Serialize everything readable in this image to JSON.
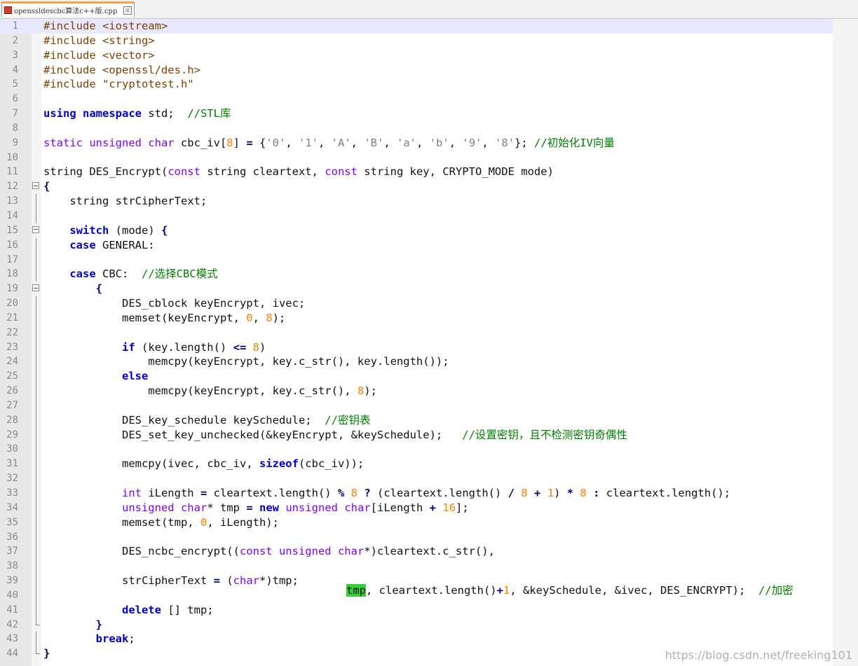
{
  "tab": {
    "filename": "openssldescbc算法c++版.cpp",
    "close": "☒"
  },
  "editor": {
    "current_line": 1,
    "lines": [
      {
        "n": "1",
        "tokens": [
          {
            "t": "#include <iostream>",
            "c": "pp"
          }
        ]
      },
      {
        "n": "2",
        "tokens": [
          {
            "t": "#include <string>",
            "c": "pp"
          }
        ]
      },
      {
        "n": "3",
        "tokens": [
          {
            "t": "#include <vector>",
            "c": "pp"
          }
        ]
      },
      {
        "n": "4",
        "tokens": [
          {
            "t": "#include <openssl/des.h>",
            "c": "pp"
          }
        ]
      },
      {
        "n": "5",
        "tokens": [
          {
            "t": "#include \"cryptotest.h\"",
            "c": "pp"
          }
        ]
      },
      {
        "n": "6",
        "tokens": []
      },
      {
        "n": "7",
        "tokens": [
          {
            "t": "using namespace",
            "c": "kw"
          },
          {
            "t": " std;  "
          },
          {
            "t": "//STL库",
            "c": "cm"
          }
        ]
      },
      {
        "n": "8",
        "tokens": []
      },
      {
        "n": "9",
        "tokens": [
          {
            "t": "static unsigned char",
            "c": "tp"
          },
          {
            "t": " cbc_iv["
          },
          {
            "t": "8",
            "c": "num"
          },
          {
            "t": "] "
          },
          {
            "t": "=",
            "c": "op"
          },
          {
            "t": " {"
          },
          {
            "t": "'0'",
            "c": "str"
          },
          {
            "t": ", "
          },
          {
            "t": "'1'",
            "c": "str"
          },
          {
            "t": ", "
          },
          {
            "t": "'A'",
            "c": "str"
          },
          {
            "t": ", "
          },
          {
            "t": "'B'",
            "c": "str"
          },
          {
            "t": ", "
          },
          {
            "t": "'a'",
            "c": "str"
          },
          {
            "t": ", "
          },
          {
            "t": "'b'",
            "c": "str"
          },
          {
            "t": ", "
          },
          {
            "t": "'9'",
            "c": "str"
          },
          {
            "t": ", "
          },
          {
            "t": "'8'",
            "c": "str"
          },
          {
            "t": "}; "
          },
          {
            "t": "//初始化IV向量",
            "c": "cm"
          }
        ]
      },
      {
        "n": "10",
        "tokens": []
      },
      {
        "n": "11",
        "tokens": [
          {
            "t": "string DES_Encrypt("
          },
          {
            "t": "const",
            "c": "tp"
          },
          {
            "t": " string cleartext, "
          },
          {
            "t": "const",
            "c": "tp"
          },
          {
            "t": " string key, CRYPTO_MODE mode)"
          }
        ]
      },
      {
        "n": "12",
        "fold": "box",
        "tokens": [
          {
            "t": "{",
            "c": "op"
          }
        ]
      },
      {
        "n": "13",
        "fold": "vline",
        "tokens": [
          {
            "t": "    string strCipherText;"
          }
        ]
      },
      {
        "n": "14",
        "fold": "vline",
        "tokens": []
      },
      {
        "n": "15",
        "fold": "box",
        "tokens": [
          {
            "t": "    "
          },
          {
            "t": "switch",
            "c": "kw"
          },
          {
            "t": " (mode) "
          },
          {
            "t": "{",
            "c": "op"
          }
        ]
      },
      {
        "n": "16",
        "fold": "vline",
        "tokens": [
          {
            "t": "    "
          },
          {
            "t": "case",
            "c": "kw"
          },
          {
            "t": " GENERAL:"
          }
        ]
      },
      {
        "n": "17",
        "fold": "vline",
        "tokens": []
      },
      {
        "n": "18",
        "fold": "vline",
        "tokens": [
          {
            "t": "    "
          },
          {
            "t": "case",
            "c": "kw"
          },
          {
            "t": " CBC:  "
          },
          {
            "t": "//选择CBC模式",
            "c": "cm"
          }
        ]
      },
      {
        "n": "19",
        "fold": "box",
        "tokens": [
          {
            "t": "        "
          },
          {
            "t": "{",
            "c": "op"
          }
        ]
      },
      {
        "n": "20",
        "fold": "vline",
        "tokens": [
          {
            "t": "            DES_cblock keyEncrypt, ivec;"
          }
        ]
      },
      {
        "n": "21",
        "fold": "vline",
        "tokens": [
          {
            "t": "            memset(keyEncrypt, "
          },
          {
            "t": "0",
            "c": "num"
          },
          {
            "t": ", "
          },
          {
            "t": "8",
            "c": "num"
          },
          {
            "t": ");"
          }
        ]
      },
      {
        "n": "22",
        "fold": "vline",
        "tokens": []
      },
      {
        "n": "23",
        "fold": "vline",
        "tokens": [
          {
            "t": "            "
          },
          {
            "t": "if",
            "c": "kw"
          },
          {
            "t": " (key.length() "
          },
          {
            "t": "<=",
            "c": "op"
          },
          {
            "t": " "
          },
          {
            "t": "8",
            "c": "num"
          },
          {
            "t": ")"
          }
        ]
      },
      {
        "n": "24",
        "fold": "vline",
        "tokens": [
          {
            "t": "                memcpy(keyEncrypt, key.c_str(), key.length());"
          }
        ]
      },
      {
        "n": "25",
        "fold": "vline",
        "tokens": [
          {
            "t": "            "
          },
          {
            "t": "else",
            "c": "kw"
          }
        ]
      },
      {
        "n": "26",
        "fold": "vline",
        "tokens": [
          {
            "t": "                memcpy(keyEncrypt, key.c_str(), "
          },
          {
            "t": "8",
            "c": "num"
          },
          {
            "t": ");"
          }
        ]
      },
      {
        "n": "27",
        "fold": "vline",
        "tokens": []
      },
      {
        "n": "28",
        "fold": "vline",
        "tokens": [
          {
            "t": "            DES_key_schedule keySchedule;  "
          },
          {
            "t": "//密钥表",
            "c": "cm"
          }
        ]
      },
      {
        "n": "29",
        "fold": "vline",
        "tokens": [
          {
            "t": "            DES_set_key_unchecked(&keyEncrypt, &keySchedule);   "
          },
          {
            "t": "//设置密钥，且不检测密钥奇偶性",
            "c": "cm"
          }
        ]
      },
      {
        "n": "30",
        "fold": "vline",
        "tokens": []
      },
      {
        "n": "31",
        "fold": "vline",
        "tokens": [
          {
            "t": "            memcpy(ivec, cbc_iv, "
          },
          {
            "t": "sizeof",
            "c": "kw"
          },
          {
            "t": "(cbc_iv));"
          }
        ]
      },
      {
        "n": "32",
        "fold": "vline",
        "tokens": []
      },
      {
        "n": "33",
        "fold": "vline",
        "tokens": [
          {
            "t": "            "
          },
          {
            "t": "int",
            "c": "tp"
          },
          {
            "t": " iLength "
          },
          {
            "t": "=",
            "c": "op"
          },
          {
            "t": " cleartext.length() "
          },
          {
            "t": "%",
            "c": "op"
          },
          {
            "t": " "
          },
          {
            "t": "8",
            "c": "num"
          },
          {
            "t": " "
          },
          {
            "t": "?",
            "c": "op"
          },
          {
            "t": " (cleartext.length() "
          },
          {
            "t": "/",
            "c": "op"
          },
          {
            "t": " "
          },
          {
            "t": "8",
            "c": "num"
          },
          {
            "t": " "
          },
          {
            "t": "+",
            "c": "op"
          },
          {
            "t": " "
          },
          {
            "t": "1",
            "c": "num"
          },
          {
            "t": ") "
          },
          {
            "t": "*",
            "c": "op"
          },
          {
            "t": " "
          },
          {
            "t": "8",
            "c": "num"
          },
          {
            "t": " "
          },
          {
            "t": ":",
            "c": "op"
          },
          {
            "t": " cleartext.length();"
          }
        ]
      },
      {
        "n": "34",
        "fold": "vline",
        "tokens": [
          {
            "t": "            "
          },
          {
            "t": "unsigned char",
            "c": "tp"
          },
          {
            "t": "* tmp "
          },
          {
            "t": "=",
            "c": "op"
          },
          {
            "t": " "
          },
          {
            "t": "new",
            "c": "kw"
          },
          {
            "t": " "
          },
          {
            "t": "unsigned char",
            "c": "tp"
          },
          {
            "t": "[iLength "
          },
          {
            "t": "+",
            "c": "op"
          },
          {
            "t": " "
          },
          {
            "t": "16",
            "c": "num"
          },
          {
            "t": "];"
          }
        ]
      },
      {
        "n": "35",
        "fold": "vline",
        "tokens": [
          {
            "t": "            memset(tmp, "
          },
          {
            "t": "0",
            "c": "num"
          },
          {
            "t": ", iLength);"
          }
        ]
      },
      {
        "n": "36",
        "fold": "vline",
        "tokens": []
      },
      {
        "n": "37",
        "fold": "vline",
        "tokens": [
          {
            "t": "            DES_ncbc_encrypt(("
          },
          {
            "t": "const unsigned char",
            "c": "tp"
          },
          {
            "t": "*)cleartext.c_str(),"
          }
        ]
      },
      {
        "n": "38",
        "fold": "vline",
        "tokens": []
      },
      {
        "n": "39",
        "fold": "vline",
        "tokens": [
          {
            "t": "            strCipherText "
          },
          {
            "t": "=",
            "c": "op"
          },
          {
            "t": " ("
          },
          {
            "t": "char",
            "c": "tp"
          },
          {
            "t": "*)tmp;"
          }
        ]
      },
      {
        "n": "40",
        "fold": "vline",
        "tokens": []
      },
      {
        "n": "41",
        "fold": "vline",
        "tokens": [
          {
            "t": "            "
          },
          {
            "t": "delete",
            "c": "kw"
          },
          {
            "t": " [] tmp;"
          }
        ]
      },
      {
        "n": "42",
        "fold": "end",
        "tokens": [
          {
            "t": "        "
          },
          {
            "t": "}",
            "c": "op"
          }
        ]
      },
      {
        "n": "43",
        "fold": "vline",
        "tokens": [
          {
            "t": "        "
          },
          {
            "t": "break",
            "c": "kw"
          },
          {
            "t": ";"
          }
        ]
      },
      {
        "n": "44",
        "fold": "end",
        "tokens": [
          {
            "t": "}",
            "c": "op"
          }
        ]
      }
    ],
    "overflow_line": [
      {
        "t": "tmp",
        "c": "hl"
      },
      {
        "t": ", cleartext.length()"
      },
      {
        "t": "+",
        "c": "op"
      },
      {
        "t": "1",
        "c": "num"
      },
      {
        "t": ", &keySchedule, &ivec, DES_ENCRYPT);  "
      },
      {
        "t": "//加密",
        "c": "cm"
      }
    ]
  },
  "watermark": "https://blog.csdn.net/freeking101"
}
